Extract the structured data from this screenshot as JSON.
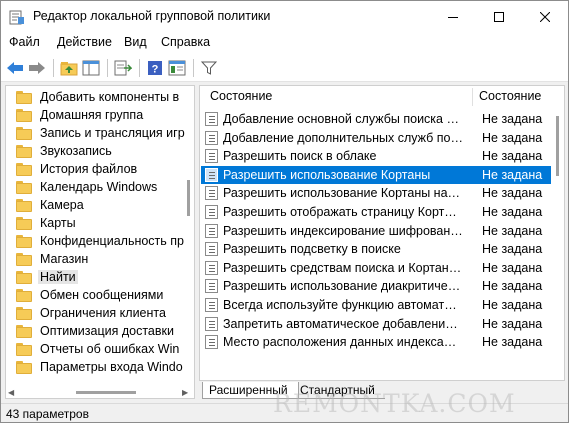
{
  "window": {
    "title": "Редактор локальной групповой политики"
  },
  "menu": [
    "Файл",
    "Действие",
    "Вид",
    "Справка"
  ],
  "tree": {
    "items": [
      {
        "label": "Добавить компоненты в"
      },
      {
        "label": "Домашняя группа"
      },
      {
        "label": "Запись и трансляция игр"
      },
      {
        "label": "Звукозапись"
      },
      {
        "label": "История файлов"
      },
      {
        "label": "Календарь Windows"
      },
      {
        "label": "Камера"
      },
      {
        "label": "Карты"
      },
      {
        "label": "Конфиденциальность пр"
      },
      {
        "label": "Магазин"
      },
      {
        "label": "Найти",
        "selected": true
      },
      {
        "label": "Обмен сообщениями"
      },
      {
        "label": "Ограничения клиента"
      },
      {
        "label": "Оптимизация доставки"
      },
      {
        "label": "Отчеты об ошибках Win"
      },
      {
        "label": "Параметры входа Windo"
      }
    ]
  },
  "list": {
    "header_name": "Состояние",
    "header_state": "Состояние",
    "rows": [
      {
        "name": "Добавление основной службы поиска в ...",
        "state": "Не задана"
      },
      {
        "name": "Добавление дополнительных служб пои...",
        "state": "Не задана"
      },
      {
        "name": "Разрешить поиск в облаке",
        "state": "Не задана"
      },
      {
        "name": "Разрешить использование Кортаны",
        "state": "Не задана",
        "selected": true
      },
      {
        "name": "Разрешить использование Кортаны на э...",
        "state": "Не задана"
      },
      {
        "name": "Разрешить отображать страницу Кортан...",
        "state": "Не задана"
      },
      {
        "name": "Разрешить индексирование шифрованн...",
        "state": "Не задана"
      },
      {
        "name": "Разрешить подсветку в поиске",
        "state": "Не задана"
      },
      {
        "name": "Разрешить средствам поиска и Кортане ...",
        "state": "Не задана"
      },
      {
        "name": "Разрешить использование диакритическ...",
        "state": "Не задана"
      },
      {
        "name": "Всегда используйте функцию автоматич...",
        "state": "Не задана"
      },
      {
        "name": "Запретить автоматическое добавление о...",
        "state": "Не задана"
      },
      {
        "name": "Место расположения данных индексации",
        "state": "Не задана"
      }
    ]
  },
  "tabs": [
    "Расширенный",
    "Стандартный"
  ],
  "status": {
    "text": "43 параметров"
  },
  "watermark": "REMONTKA.COM",
  "colors": {
    "selection": "#0078d7",
    "folder": "#f6cb57"
  }
}
